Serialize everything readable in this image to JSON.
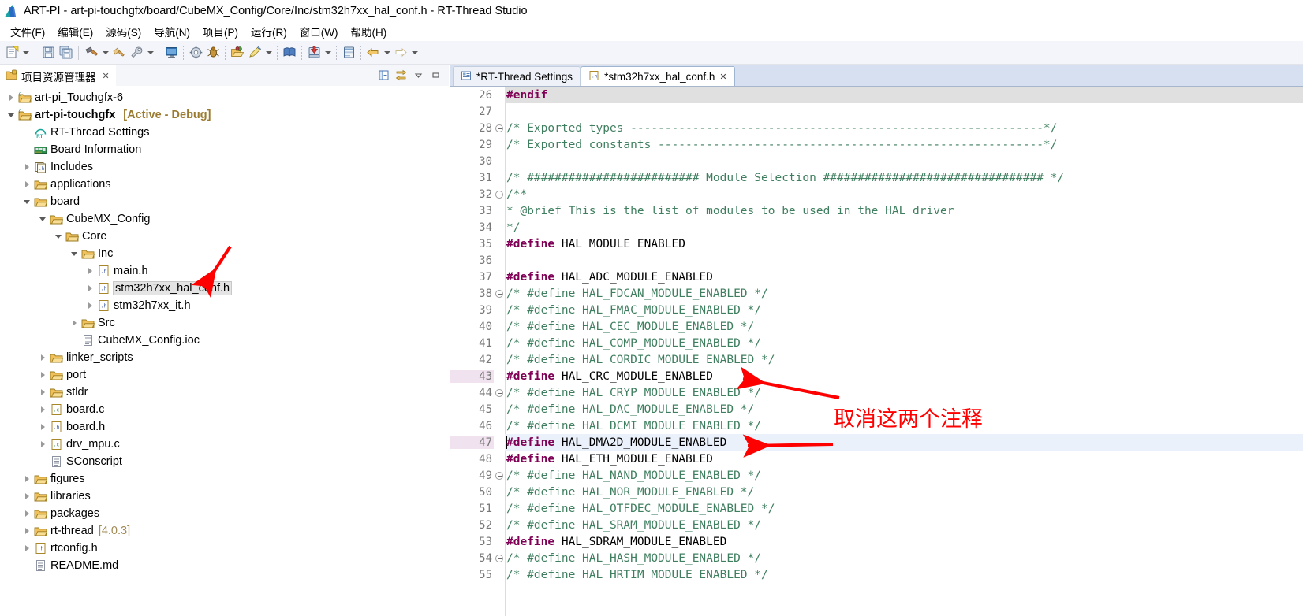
{
  "window": {
    "title": "ART-PI - art-pi-touchgfx/board/CubeMX_Config/Core/Inc/stm32h7xx_hal_conf.h - RT-Thread Studio",
    "app_icon": "rt-thread-studio-icon"
  },
  "menubar": [
    {
      "label": "文件(F)",
      "name": "menu-file"
    },
    {
      "label": "编辑(E)",
      "name": "menu-edit"
    },
    {
      "label": "源码(S)",
      "name": "menu-source"
    },
    {
      "label": "导航(N)",
      "name": "menu-navigate"
    },
    {
      "label": "项目(P)",
      "name": "menu-project"
    },
    {
      "label": "运行(R)",
      "name": "menu-run"
    },
    {
      "label": "窗口(W)",
      "name": "menu-window"
    },
    {
      "label": "帮助(H)",
      "name": "menu-help"
    }
  ],
  "toolbar": {
    "items": [
      {
        "name": "new-file-icon",
        "caret": true
      },
      {
        "sep": "solid"
      },
      {
        "name": "save-icon",
        "caret": false
      },
      {
        "name": "save-all-icon",
        "caret": false
      },
      {
        "sep": "solid"
      },
      {
        "name": "build-hammer-icon",
        "caret": true
      },
      {
        "name": "clean-icon",
        "caret": false
      },
      {
        "name": "settings-wrench-icon",
        "caret": true
      },
      {
        "sep": "dotted"
      },
      {
        "name": "terminal-icon",
        "caret": false
      },
      {
        "sep": "dotted"
      },
      {
        "name": "gear-icon",
        "caret": false
      },
      {
        "name": "debug-bug-icon",
        "caret": false
      },
      {
        "sep": "dotted"
      },
      {
        "name": "open-package-icon",
        "caret": false
      },
      {
        "name": "pencil-icon",
        "caret": true
      },
      {
        "sep": "dotted"
      },
      {
        "name": "book-icon",
        "caret": false
      },
      {
        "sep": "dotted"
      },
      {
        "name": "download-icon",
        "caret": true
      },
      {
        "sep": "dotted"
      },
      {
        "name": "console-icon",
        "caret": false
      },
      {
        "sep": "dotted"
      },
      {
        "name": "back-arrow-icon",
        "caret": true
      },
      {
        "name": "forward-arrow-icon",
        "caret": true
      }
    ]
  },
  "left_panel": {
    "tab": {
      "label": "项目资源管理器",
      "icon": "project-explorer-icon",
      "close": "✕"
    },
    "view_tools": [
      {
        "name": "collapse-all-icon"
      },
      {
        "name": "link-with-editor-icon"
      },
      {
        "name": "view-menu-icon"
      },
      {
        "name": "minimize-view-icon"
      }
    ],
    "tree": [
      {
        "indent": 0,
        "twist": "collapsed",
        "icon": "c-project-icon",
        "label": "art-pi_Touchgfx-6",
        "bold": false,
        "suffix": "",
        "selected": false
      },
      {
        "indent": 0,
        "twist": "expanded",
        "icon": "c-project-icon",
        "label": "art-pi-touchgfx",
        "bold": true,
        "suffix": "[Active - Debug]",
        "suffix_style": "bold",
        "selected": false
      },
      {
        "indent": 1,
        "twist": "none",
        "icon": "rt-settings-icon",
        "label": "RT-Thread Settings",
        "bold": false,
        "suffix": "",
        "selected": false
      },
      {
        "indent": 1,
        "twist": "none",
        "icon": "board-info-icon",
        "label": "Board Information",
        "bold": false,
        "suffix": "",
        "selected": false
      },
      {
        "indent": 1,
        "twist": "collapsed",
        "icon": "includes-icon",
        "label": "Includes",
        "bold": false,
        "suffix": "",
        "selected": false
      },
      {
        "indent": 1,
        "twist": "collapsed",
        "icon": "folder-icon",
        "label": "applications",
        "bold": false,
        "suffix": "",
        "selected": false
      },
      {
        "indent": 1,
        "twist": "expanded",
        "icon": "folder-icon",
        "label": "board",
        "bold": false,
        "suffix": "",
        "selected": false
      },
      {
        "indent": 2,
        "twist": "expanded",
        "icon": "folder-icon",
        "label": "CubeMX_Config",
        "bold": false,
        "suffix": "",
        "selected": false
      },
      {
        "indent": 3,
        "twist": "expanded",
        "icon": "folder-icon",
        "label": "Core",
        "bold": false,
        "suffix": "",
        "selected": false
      },
      {
        "indent": 4,
        "twist": "expanded",
        "icon": "folder-icon",
        "label": "Inc",
        "bold": false,
        "suffix": "",
        "selected": false
      },
      {
        "indent": 5,
        "twist": "collapsed",
        "icon": "header-file-icon",
        "label": "main.h",
        "bold": false,
        "suffix": "",
        "selected": false
      },
      {
        "indent": 5,
        "twist": "collapsed",
        "icon": "header-file-icon",
        "label": "stm32h7xx_hal_conf.h",
        "bold": false,
        "suffix": "",
        "selected": true
      },
      {
        "indent": 5,
        "twist": "collapsed",
        "icon": "header-file-icon",
        "label": "stm32h7xx_it.h",
        "bold": false,
        "suffix": "",
        "selected": false
      },
      {
        "indent": 4,
        "twist": "collapsed",
        "icon": "folder-icon",
        "label": "Src",
        "bold": false,
        "suffix": "",
        "selected": false
      },
      {
        "indent": 4,
        "twist": "none",
        "icon": "generic-file-icon",
        "label": "CubeMX_Config.ioc",
        "bold": false,
        "suffix": "",
        "selected": false
      },
      {
        "indent": 2,
        "twist": "collapsed",
        "icon": "folder-icon",
        "label": "linker_scripts",
        "bold": false,
        "suffix": "",
        "selected": false
      },
      {
        "indent": 2,
        "twist": "collapsed",
        "icon": "folder-icon",
        "label": "port",
        "bold": false,
        "suffix": "",
        "selected": false
      },
      {
        "indent": 2,
        "twist": "collapsed",
        "icon": "folder-icon",
        "label": "stldr",
        "bold": false,
        "suffix": "",
        "selected": false
      },
      {
        "indent": 2,
        "twist": "collapsed",
        "icon": "c-file-icon",
        "label": "board.c",
        "bold": false,
        "suffix": "",
        "selected": false
      },
      {
        "indent": 2,
        "twist": "collapsed",
        "icon": "header-file-icon",
        "label": "board.h",
        "bold": false,
        "suffix": "",
        "selected": false
      },
      {
        "indent": 2,
        "twist": "collapsed",
        "icon": "c-file-icon",
        "label": "drv_mpu.c",
        "bold": false,
        "suffix": "",
        "selected": false
      },
      {
        "indent": 2,
        "twist": "none",
        "icon": "generic-file-icon",
        "label": "SConscript",
        "bold": false,
        "suffix": "",
        "selected": false
      },
      {
        "indent": 1,
        "twist": "collapsed",
        "icon": "folder-icon",
        "label": "figures",
        "bold": false,
        "suffix": "",
        "selected": false
      },
      {
        "indent": 1,
        "twist": "collapsed",
        "icon": "folder-icon",
        "label": "libraries",
        "bold": false,
        "suffix": "",
        "selected": false
      },
      {
        "indent": 1,
        "twist": "collapsed",
        "icon": "folder-icon",
        "label": "packages",
        "bold": false,
        "suffix": "",
        "selected": false
      },
      {
        "indent": 1,
        "twist": "collapsed",
        "icon": "folder-icon",
        "label": "rt-thread",
        "bold": false,
        "suffix": "[4.0.3]",
        "suffix_style": "plain",
        "selected": false
      },
      {
        "indent": 1,
        "twist": "collapsed",
        "icon": "header-file-icon",
        "label": "rtconfig.h",
        "bold": false,
        "suffix": "",
        "selected": false
      },
      {
        "indent": 1,
        "twist": "none",
        "icon": "generic-file-icon",
        "label": "README.md",
        "bold": false,
        "suffix": "",
        "selected": false
      }
    ]
  },
  "editor": {
    "tabs": [
      {
        "label": "*RT-Thread Settings",
        "icon": "rt-settings-tab-icon",
        "active": false,
        "close": ""
      },
      {
        "label": "*stm32h7xx_hal_conf.h",
        "icon": "header-file-tab-icon",
        "active": true,
        "close": "✕"
      }
    ],
    "lines": [
      {
        "n": "26",
        "fold": "",
        "bg": "gray",
        "tokens": [
          {
            "t": "#endif",
            "c": "kw"
          }
        ]
      },
      {
        "n": "27",
        "fold": "",
        "bg": "",
        "tokens": []
      },
      {
        "n": "28",
        "fold": "minus",
        "bg": "",
        "tokens": [
          {
            "t": "/* Exported types ------------------------------------------------------------*/",
            "c": "cmt"
          }
        ]
      },
      {
        "n": "29",
        "fold": "",
        "bg": "",
        "tokens": [
          {
            "t": "/* Exported constants --------------------------------------------------------*/",
            "c": "cmt"
          }
        ]
      },
      {
        "n": "30",
        "fold": "",
        "bg": "",
        "tokens": []
      },
      {
        "n": "31",
        "fold": "",
        "bg": "",
        "tokens": [
          {
            "t": "/* ######################### Module Selection ################################ */",
            "c": "cmt"
          }
        ]
      },
      {
        "n": "32",
        "fold": "minus",
        "bg": "",
        "tokens": [
          {
            "t": "/**",
            "c": "cmt"
          }
        ]
      },
      {
        "n": "33",
        "fold": "",
        "bg": "",
        "tokens": [
          {
            "t": "  * @brief This is the list of modules to be used in the HAL driver",
            "c": "cmt"
          }
        ]
      },
      {
        "n": "34",
        "fold": "",
        "bg": "",
        "tokens": [
          {
            "t": "  */",
            "c": "cmt"
          }
        ]
      },
      {
        "n": "35",
        "fold": "",
        "bg": "",
        "tokens": [
          {
            "t": "#define",
            "c": "kw"
          },
          {
            "t": " HAL_MODULE_ENABLED",
            "c": "txt"
          }
        ]
      },
      {
        "n": "36",
        "fold": "",
        "bg": "",
        "tokens": []
      },
      {
        "n": "37",
        "fold": "",
        "bg": "",
        "tokens": [
          {
            "t": "  ",
            "c": "txt"
          },
          {
            "t": "#define",
            "c": "kw"
          },
          {
            "t": " HAL_ADC_MODULE_ENABLED",
            "c": "txt"
          }
        ]
      },
      {
        "n": "38",
        "fold": "minus",
        "bg": "",
        "tokens": [
          {
            "t": "/* #define HAL_FDCAN_MODULE_ENABLED   */",
            "c": "cmt"
          }
        ]
      },
      {
        "n": "39",
        "fold": "",
        "bg": "",
        "tokens": [
          {
            "t": "/* #define HAL_FMAC_MODULE_ENABLED   */",
            "c": "cmt"
          }
        ]
      },
      {
        "n": "40",
        "fold": "",
        "bg": "",
        "tokens": [
          {
            "t": "/* #define HAL_CEC_MODULE_ENABLED    */",
            "c": "cmt"
          }
        ]
      },
      {
        "n": "41",
        "fold": "",
        "bg": "",
        "tokens": [
          {
            "t": "/* #define HAL_COMP_MODULE_ENABLED   */",
            "c": "cmt"
          }
        ]
      },
      {
        "n": "42",
        "fold": "",
        "bg": "",
        "tokens": [
          {
            "t": "/* #define HAL_CORDIC_MODULE_ENABLED    */",
            "c": "cmt"
          }
        ]
      },
      {
        "n": "43",
        "fold": "",
        "bg": "",
        "gutter_hl": true,
        "tokens": [
          {
            "t": "#define",
            "c": "kw"
          },
          {
            "t": " HAL_CRC_MODULE_ENABLED",
            "c": "txt"
          }
        ]
      },
      {
        "n": "44",
        "fold": "minus",
        "bg": "",
        "tokens": [
          {
            "t": "/* #define HAL_CRYP_MODULE_ENABLED   */",
            "c": "cmt"
          }
        ]
      },
      {
        "n": "45",
        "fold": "",
        "bg": "",
        "tokens": [
          {
            "t": "/* #define HAL_DAC_MODULE_ENABLED    */",
            "c": "cmt"
          }
        ]
      },
      {
        "n": "46",
        "fold": "",
        "bg": "",
        "tokens": [
          {
            "t": "/* #define HAL_DCMI_MODULE_ENABLED   */",
            "c": "cmt"
          }
        ]
      },
      {
        "n": "47",
        "fold": "",
        "bg": "current",
        "gutter_hl": true,
        "caret": true,
        "tokens": [
          {
            "t": "#define",
            "c": "kw"
          },
          {
            "t": " HAL_DMA2D_MODULE_ENABLED",
            "c": "txt"
          }
        ]
      },
      {
        "n": "48",
        "fold": "",
        "bg": "",
        "tokens": [
          {
            "t": "#define",
            "c": "kw"
          },
          {
            "t": " HAL_ETH_MODULE_ENABLED",
            "c": "txt"
          }
        ]
      },
      {
        "n": "49",
        "fold": "minus",
        "bg": "",
        "tokens": [
          {
            "t": "/* #define HAL_NAND_MODULE_ENABLED   */",
            "c": "cmt"
          }
        ]
      },
      {
        "n": "50",
        "fold": "",
        "bg": "",
        "tokens": [
          {
            "t": "/* #define HAL_NOR_MODULE_ENABLED    */",
            "c": "cmt"
          }
        ]
      },
      {
        "n": "51",
        "fold": "",
        "bg": "",
        "tokens": [
          {
            "t": "/* #define HAL_OTFDEC_MODULE_ENABLED   */",
            "c": "cmt"
          }
        ]
      },
      {
        "n": "52",
        "fold": "",
        "bg": "",
        "tokens": [
          {
            "t": "/* #define HAL_SRAM_MODULE_ENABLED   */",
            "c": "cmt"
          }
        ]
      },
      {
        "n": "53",
        "fold": "",
        "bg": "",
        "tokens": [
          {
            "t": "#define",
            "c": "kw"
          },
          {
            "t": " HAL_SDRAM_MODULE_ENABLED",
            "c": "txt"
          }
        ]
      },
      {
        "n": "54",
        "fold": "minus",
        "bg": "",
        "tokens": [
          {
            "t": "/* #define HAL_HASH_MODULE_ENABLED   */",
            "c": "cmt"
          }
        ]
      },
      {
        "n": "55",
        "fold": "",
        "bg": "",
        "tokens": [
          {
            "t": "/* #define HAL_HRTIM_MODULE_ENABLED   */",
            "c": "cmt"
          }
        ]
      }
    ]
  },
  "annotations": {
    "color": "#ff0000",
    "note_text": "取消这两个注释",
    "arrows": [
      {
        "name": "arrow-to-tree-file"
      },
      {
        "name": "arrow-to-line-43"
      },
      {
        "name": "arrow-to-line-47"
      }
    ]
  }
}
